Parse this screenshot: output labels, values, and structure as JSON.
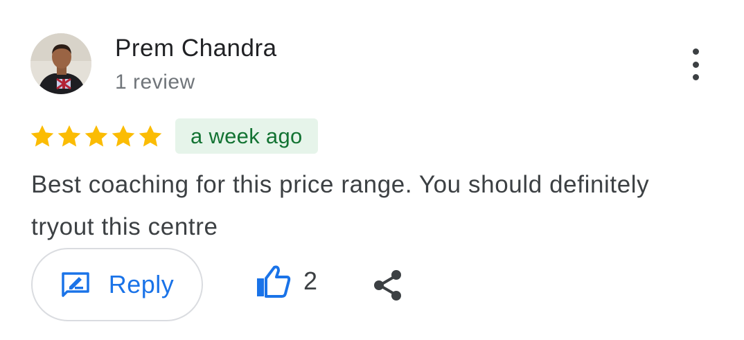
{
  "reviewer": {
    "name": "Prem Chandra",
    "meta": "1 review"
  },
  "rating": {
    "stars": 5,
    "max": 5,
    "color": "#fbbc04"
  },
  "time_badge": "a week ago",
  "review_text": "Best coaching for this price range. You should definitely tryout this centre",
  "actions": {
    "reply_label": "Reply",
    "like_count": "2"
  },
  "icons": {
    "more": "more-vert-icon",
    "reply": "rate-review-icon",
    "like": "thumb-up-icon",
    "share": "share-icon"
  },
  "colors": {
    "accent": "#1a73e8",
    "badge_bg": "#e6f4ea",
    "badge_text": "#137333"
  }
}
